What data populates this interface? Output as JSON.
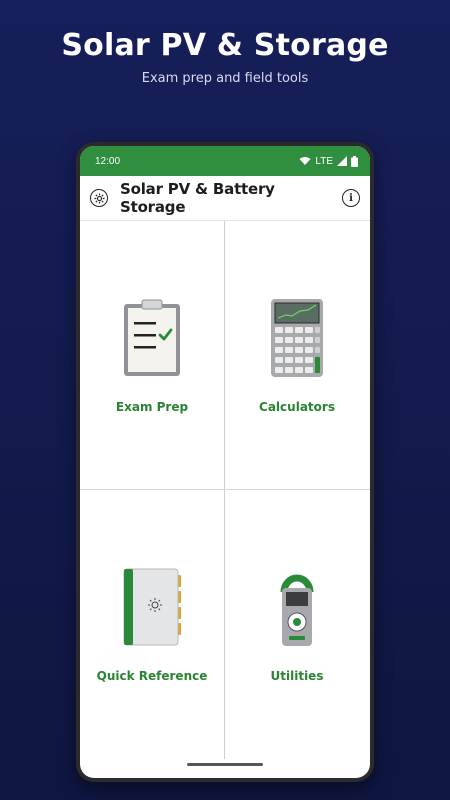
{
  "promo": {
    "title": "Solar PV & Storage",
    "subtitle": "Exam prep and field tools"
  },
  "status_bar": {
    "time": "12:00",
    "network": "LTE",
    "icons": [
      "wifi-icon",
      "signal-icon",
      "battery-icon"
    ]
  },
  "app_bar": {
    "title": "Solar PV & Battery Storage",
    "left_icon": "settings-icon",
    "right_icon": "info-icon"
  },
  "tiles": [
    {
      "label": "Exam Prep",
      "icon": "clipboard-check-icon"
    },
    {
      "label": "Calculators",
      "icon": "calculator-icon"
    },
    {
      "label": "Quick Reference",
      "icon": "reference-book-icon"
    },
    {
      "label": "Utilities",
      "icon": "clamp-meter-icon"
    }
  ],
  "colors": {
    "brand_green": "#2f8f3e",
    "label_green": "#2a8433",
    "background_navy": "#141c50"
  }
}
